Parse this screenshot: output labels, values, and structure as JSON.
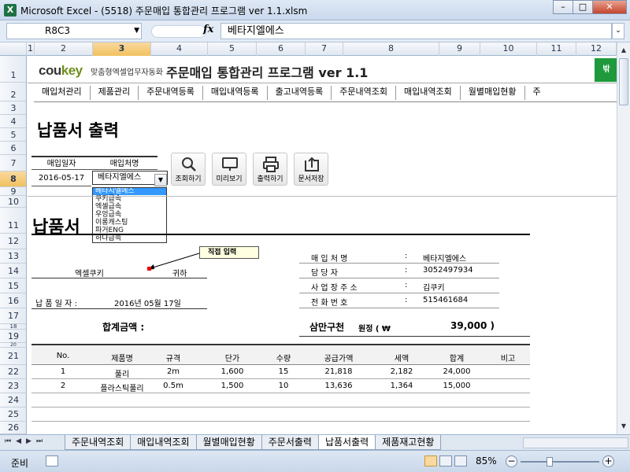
{
  "window": {
    "title": "Microsoft Excel - (5518) 주문매입 통합관리 프로그램 ver 1.1.xlsm",
    "app_icon": "X"
  },
  "formula_bar": {
    "name_box": "R8C3",
    "fx": "fx",
    "formula": "베타지엘에스"
  },
  "columns": [
    "1",
    "2",
    "3",
    "4",
    "5",
    "6",
    "7",
    "8",
    "9",
    "10",
    "11",
    "12"
  ],
  "rows": [
    "1",
    "2",
    "3",
    "4",
    "5",
    "6",
    "7",
    "8",
    "9",
    "10",
    "11",
    "12",
    "13",
    "14",
    "15",
    "16",
    "17",
    "18",
    "19",
    "20",
    "21",
    "22",
    "23",
    "24",
    "25",
    "26"
  ],
  "header": {
    "logo_main": "cou",
    "logo_accent": "key",
    "logo_sub": "맞춤형엑셀업무자동화",
    "title": "주문매입 통합관리 프로그램 ver 1.1",
    "green_button": "밖"
  },
  "menu": [
    "매입처관리",
    "제품관리",
    "주문내역등록",
    "매입내역등록",
    "출고내역등록",
    "주문내역조회",
    "매입내역조회",
    "월별매입현황",
    "주"
  ],
  "page": {
    "section_title": "납품서 출력"
  },
  "filter": {
    "date_label": "매입일자",
    "vendor_label": "매입처명",
    "date_value": "2016-05-17",
    "vendor_value": "베타지엘에스",
    "options": [
      "베타지엘에스",
      "쿠키급속",
      "엑셀급속",
      "우엉급속",
      "이롱캐스팅",
      "파거ENG",
      "하나급속"
    ]
  },
  "toolbar": {
    "search": "조회하기",
    "preview": "미리보기",
    "print": "출력하기",
    "save": "문서저장"
  },
  "doc": {
    "title": "납품서",
    "note": "직접 입력",
    "recipient": "엑셀쿠키",
    "honorific": "귀하",
    "date_label": "납 품 일 자 :",
    "date_value": "2016년 05월 17일",
    "total_label": "합계금액 :",
    "total_korean": "삼만구천",
    "total_unit": "원정 ( ₩",
    "total_value": "39,000 )",
    "vendor_info": [
      {
        "label": "매 입 처 명",
        "value": "베타지엘에스"
      },
      {
        "label": "담 당 자",
        "value": "3052497934"
      },
      {
        "label": "사 업 장 주 소",
        "value": "김쿠키"
      },
      {
        "label": "전 화 번 호",
        "value": "515461684"
      }
    ],
    "colon": ":"
  },
  "items": {
    "headers": [
      "No.",
      "제품명",
      "규격",
      "단가",
      "수량",
      "공급가액",
      "세액",
      "합계",
      "비고"
    ],
    "rows": [
      [
        "1",
        "풀리",
        "2m",
        "1,600",
        "15",
        "21,818",
        "2,182",
        "24,000",
        ""
      ],
      [
        "2",
        "플라스틱풀리",
        "0.5m",
        "1,500",
        "10",
        "13,636",
        "1,364",
        "15,000",
        ""
      ]
    ]
  },
  "tabs": [
    "주문내역조회",
    "매입내역조회",
    "월별매입현황",
    "주문서출력",
    "납품서출력",
    "제품재고현황"
  ],
  "active_tab": "납품서출력",
  "status": {
    "ready": "준비",
    "zoom": "85%"
  }
}
